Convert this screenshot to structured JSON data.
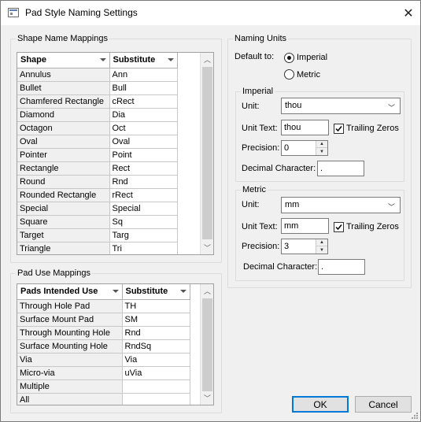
{
  "window": {
    "title": "Pad Style Naming Settings"
  },
  "shape_group": {
    "legend": "Shape Name Mappings",
    "columns": [
      "Shape",
      "Substitute"
    ],
    "rows": [
      [
        "Annulus",
        "Ann"
      ],
      [
        "Bullet",
        "Bull"
      ],
      [
        "Chamfered Rectangle",
        "cRect"
      ],
      [
        "Diamond",
        "Dia"
      ],
      [
        "Octagon",
        "Oct"
      ],
      [
        "Oval",
        "Oval"
      ],
      [
        "Pointer",
        "Point"
      ],
      [
        "Rectangle",
        "Rect"
      ],
      [
        "Round",
        "Rnd"
      ],
      [
        "Rounded Rectangle",
        "rRect"
      ],
      [
        "Special",
        "Special"
      ],
      [
        "Square",
        "Sq"
      ],
      [
        "Target",
        "Targ"
      ],
      [
        "Triangle",
        "Tri"
      ]
    ]
  },
  "paduse_group": {
    "legend": "Pad Use Mappings",
    "columns": [
      "Pads Intended Use",
      "Substitute"
    ],
    "rows": [
      [
        "Through Hole Pad",
        "TH"
      ],
      [
        "Surface Mount Pad",
        "SM"
      ],
      [
        "Through Mounting Hole",
        "Rnd"
      ],
      [
        "Surface Mounting Hole",
        "RndSq"
      ],
      [
        "Via",
        "Via"
      ],
      [
        "Micro-via",
        "uVia"
      ],
      [
        "Multiple",
        ""
      ],
      [
        "All",
        ""
      ]
    ]
  },
  "naming_units": {
    "legend": "Naming Units",
    "default_to_label": "Default to:",
    "options": [
      "Imperial",
      "Metric"
    ],
    "selected": "Imperial",
    "imperial": {
      "legend": "Imperial",
      "unit_label": "Unit:",
      "unit_value": "thou",
      "unit_text_label": "Unit Text:",
      "unit_text_value": "thou",
      "trailing_zeros_label": "Trailing Zeros",
      "trailing_zeros_checked": true,
      "precision_label": "Precision:",
      "precision_value": "0",
      "decimal_label": "Decimal Character:",
      "decimal_value": "."
    },
    "metric": {
      "legend": "Metric",
      "unit_label": "Unit:",
      "unit_value": "mm",
      "unit_text_label": "Unit Text:",
      "unit_text_value": "mm",
      "trailing_zeros_label": "Trailing Zeros",
      "trailing_zeros_checked": true,
      "precision_label": "Precision:",
      "precision_value": "3",
      "decimal_label": "Decimal Character:",
      "decimal_value": "."
    }
  },
  "buttons": {
    "ok": "OK",
    "cancel": "Cancel"
  }
}
